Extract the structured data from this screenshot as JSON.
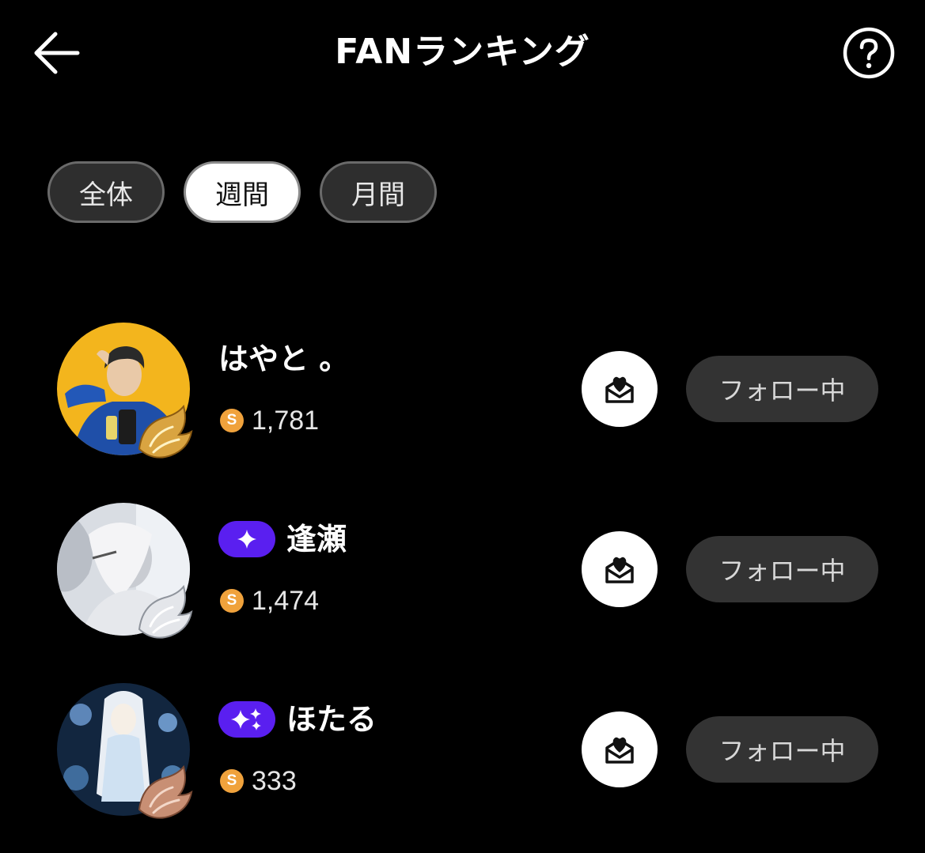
{
  "header": {
    "title": "FANランキング",
    "back_icon": "arrow-left-icon",
    "help_icon": "question-circle-icon"
  },
  "tabs": [
    {
      "label": "全体",
      "active": false
    },
    {
      "label": "週間",
      "active": true
    },
    {
      "label": "月間",
      "active": false
    }
  ],
  "ranking": [
    {
      "name": "はやと 。",
      "coins": "1,781",
      "badge": null,
      "wing": "gold"
    },
    {
      "name": "逢瀬",
      "coins": "1,474",
      "badge": "sparkle-1",
      "wing": "silver"
    },
    {
      "name": "ほたる",
      "coins": "333",
      "badge": "sparkle-2",
      "wing": "bronze"
    }
  ],
  "coin_symbol": "S",
  "follow_label": "フォロー中",
  "colors": {
    "background": "#000000",
    "badge_purple": "#5a1ff0",
    "coin_orange": "#f0a23c",
    "follow_bg": "#333333"
  }
}
